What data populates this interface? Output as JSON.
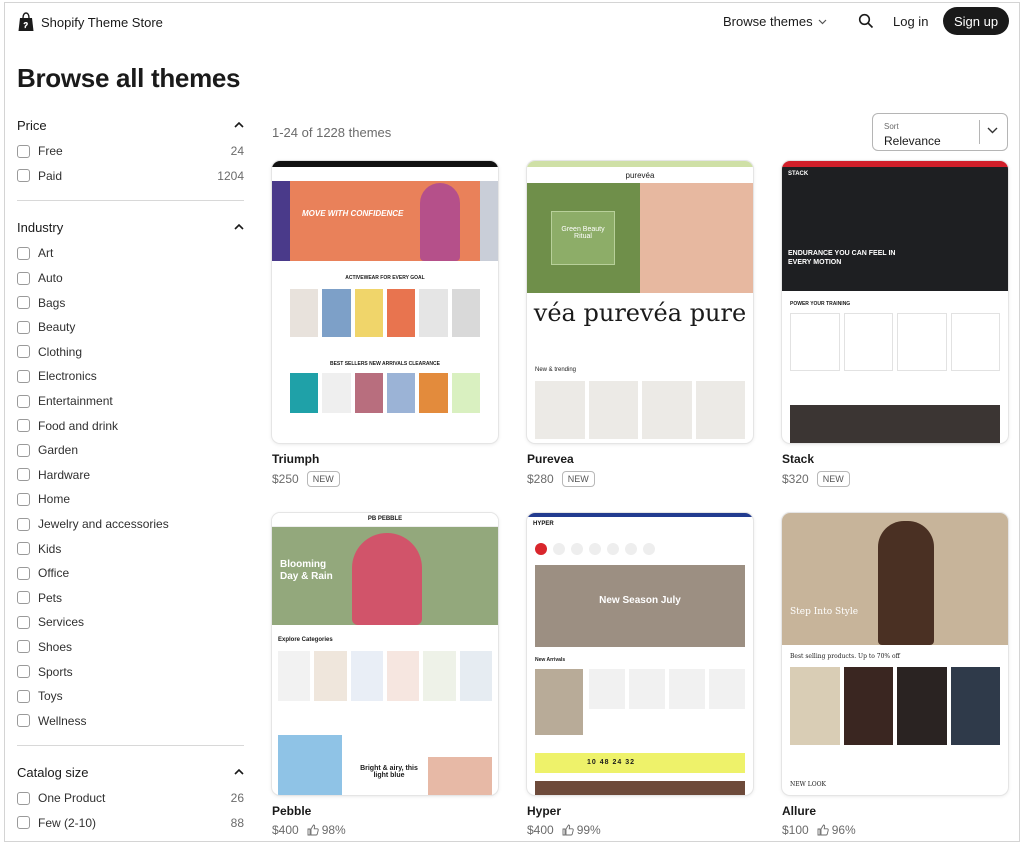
{
  "header": {
    "brand": "Shopify Theme Store",
    "browse": "Browse themes",
    "login": "Log in",
    "signup": "Sign up"
  },
  "page_title": "Browse all themes",
  "filters": [
    {
      "title": "Price",
      "options": [
        {
          "label": "Free",
          "count": "24"
        },
        {
          "label": "Paid",
          "count": "1204"
        }
      ]
    },
    {
      "title": "Industry",
      "options": [
        {
          "label": "Art"
        },
        {
          "label": "Auto"
        },
        {
          "label": "Bags"
        },
        {
          "label": "Beauty"
        },
        {
          "label": "Clothing"
        },
        {
          "label": "Electronics"
        },
        {
          "label": "Entertainment"
        },
        {
          "label": "Food and drink"
        },
        {
          "label": "Garden"
        },
        {
          "label": "Hardware"
        },
        {
          "label": "Home"
        },
        {
          "label": "Jewelry and accessories"
        },
        {
          "label": "Kids"
        },
        {
          "label": "Office"
        },
        {
          "label": "Pets"
        },
        {
          "label": "Services"
        },
        {
          "label": "Shoes"
        },
        {
          "label": "Sports"
        },
        {
          "label": "Toys"
        },
        {
          "label": "Wellness"
        }
      ]
    },
    {
      "title": "Catalog size",
      "options": [
        {
          "label": "One Product",
          "count": "26"
        },
        {
          "label": "Few (2-10)",
          "count": "88"
        }
      ]
    }
  ],
  "results_count": "1-24 of 1228 themes",
  "sort": {
    "label": "Sort",
    "value": "Relevance"
  },
  "themes": [
    {
      "name": "Triumph",
      "price": "$250",
      "badge": "NEW",
      "rating": ""
    },
    {
      "name": "Purevea",
      "price": "$280",
      "badge": "NEW",
      "rating": ""
    },
    {
      "name": "Stack",
      "price": "$320",
      "badge": "NEW",
      "rating": ""
    },
    {
      "name": "Pebble",
      "price": "$400",
      "badge": "",
      "rating": "98%"
    },
    {
      "name": "Hyper",
      "price": "$400",
      "badge": "",
      "rating": "99%"
    },
    {
      "name": "Allure",
      "price": "$100",
      "badge": "",
      "rating": "96%"
    }
  ],
  "previews": {
    "triumph": {
      "hero": "MOVE WITH CONFIDENCE",
      "section": "ACTIVEWEAR FOR EVERY GOAL",
      "tabs": "BEST SELLERS  NEW ARRIVALS  CLEARANCE"
    },
    "purevea": {
      "logo": "purevéa",
      "hero": "Green Beauty Ritual",
      "wordmark": "véa purevéa pure",
      "section": "New & trending"
    },
    "stack": {
      "logo": "STACK",
      "hero": "ENDURANCE YOU CAN FEEL IN EVERY MOTION",
      "section": "POWER YOUR TRAINING"
    },
    "pebble": {
      "logo": "PB PEBBLE",
      "hero": "Blooming Day & Rain",
      "section": "Explore Categories",
      "promo": "Bright & airy, this light blue"
    },
    "hyper": {
      "logo": "HYPER",
      "hero": "New Season July",
      "section": "New Arrivals",
      "countdown": "10  48  24  32"
    },
    "allure": {
      "hero": "Step Into Style",
      "section": "Best selling products. Up to 70% off",
      "footer": "NEW LOOK"
    }
  },
  "colors": {
    "accent": "#1a1a1a",
    "muted": "#6b6b6b",
    "border": "#d8d8d8"
  }
}
